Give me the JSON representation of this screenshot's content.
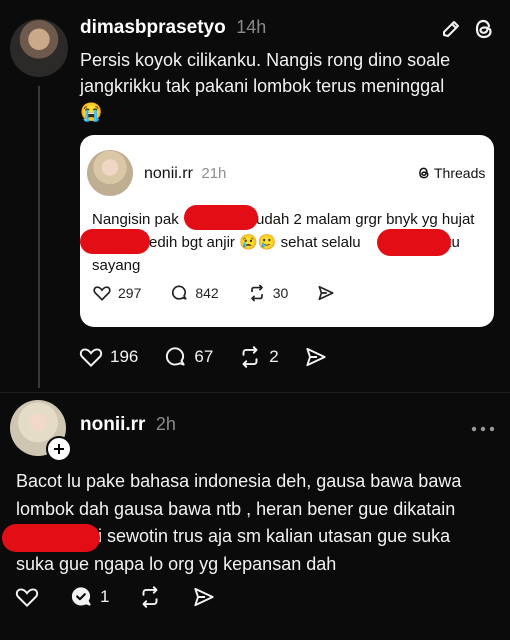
{
  "post": {
    "username": "dimasbprasetyo",
    "time": "14h",
    "text": "Persis koyok cilikanku. Nangis rong dino soale jangkrikku tak pakani lombok terus meninggal",
    "emoji": "😭",
    "actions": {
      "likes": "196",
      "replies": "67",
      "reposts": "2"
    }
  },
  "quoted": {
    "username": "nonii.rr",
    "time": "21h",
    "brand": "Threads",
    "line1_a": "Nangisin pak",
    "line1_b": "udah 2 malam grgr bnyk yg hujat",
    "line2_a": "edih bgt anjir 😢🥲 sehat selalu",
    "line2_b": "ku",
    "line3": "sayang",
    "actions": {
      "likes": "297",
      "replies": "842",
      "reposts": "30"
    }
  },
  "reply": {
    "username": "nonii.rr",
    "time": "2h",
    "line1": "Bacot lu pake bahasa indonesia deh, gausa bawa bawa",
    "line2": "lombok dah gausa bawa ntb , heran bener gue dikatain",
    "line3": "i sewotin trus aja sm kalian utasan gue suka",
    "line4": "suka gue ngapa lo org yg kepansan dah",
    "actions": {
      "replies": "1"
    }
  },
  "icons": [
    "edit-icon",
    "threads-logo-icon",
    "heart-icon",
    "comment-icon",
    "repost-icon",
    "share-icon",
    "more-icon",
    "follow-plus-icon"
  ]
}
